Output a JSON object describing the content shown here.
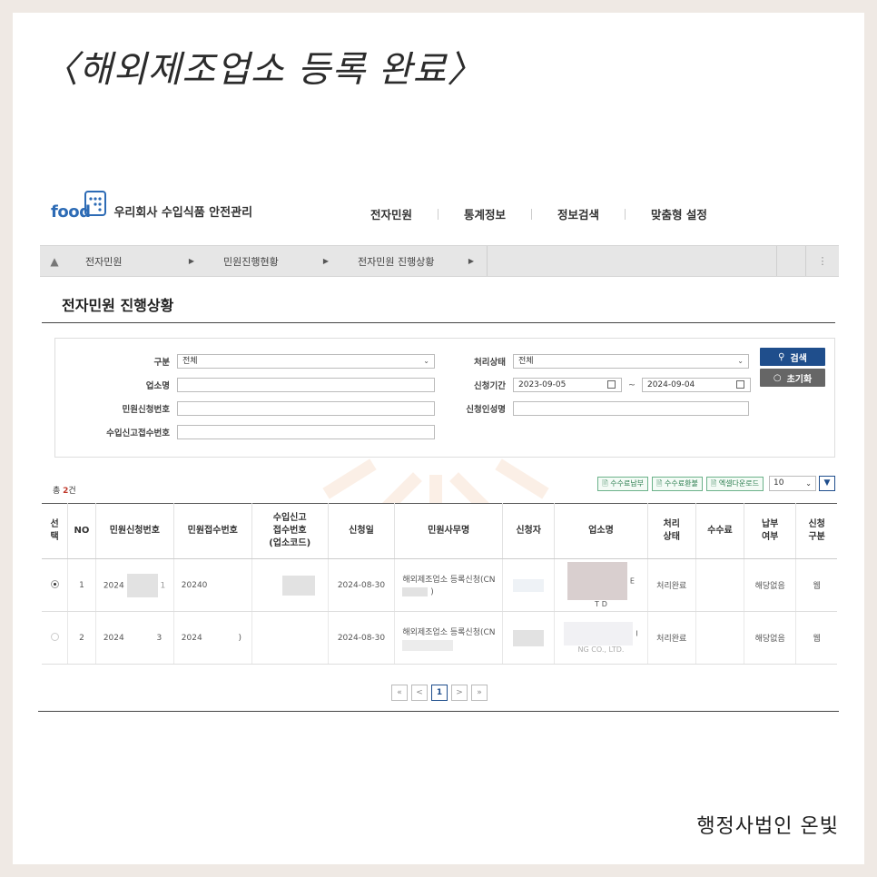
{
  "heading": "〈해외제조업소 등록 완료〉",
  "signature": "행정사법인 온빛",
  "logo": {
    "word": "food",
    "brand": "우리회사 수입식품 안전관리"
  },
  "top_nav": [
    "전자민원",
    "통계정보",
    "정보검색",
    "맞춤형 설정"
  ],
  "breadcrumb": [
    "전자민원",
    "민원진행현황",
    "전자민원 진행상황"
  ],
  "section_title": "전자민원 진행상황",
  "search": {
    "category_label": "구분",
    "category_value": "전체",
    "status_label": "처리상태",
    "status_value": "전체",
    "company_label": "업소명",
    "period_label": "신청기간",
    "date_from": "2023-09-05",
    "date_to": "2024-09-04",
    "request_no_label": "민원신청번호",
    "applicant_name_label": "신청인성명",
    "import_no_label": "수입신고접수번호",
    "search_button": "검색",
    "reset_button": "초기화"
  },
  "result": {
    "total_prefix": "총",
    "total_count": "2",
    "total_suffix": "건",
    "fee_pay": "수수료납부",
    "fee_refund": "수수료환불",
    "excel_download": "엑셀다운로드",
    "page_size": "10"
  },
  "table": {
    "headers": [
      "선\n택",
      "NO",
      "민원신청번호",
      "민원접수번호",
      "수입신고\n접수번호\n(업소코드)",
      "신청일",
      "민원사무명",
      "신청자",
      "업소명",
      "처리\n상태",
      "수수료",
      "납부\n여부",
      "신청\n구분"
    ],
    "rows": [
      {
        "no": "1",
        "req_no": "2024",
        "req_tail": "1",
        "rcpt_no": "20240",
        "date": "2024-08-30",
        "task": "해외제조업소 등록신청(CN",
        "task_tail": ")",
        "company_a": "E",
        "company_b": "T",
        "company_c": "D",
        "status": "처리완료",
        "fee": "",
        "paid": "해당없음",
        "type": "웹"
      },
      {
        "no": "2",
        "req_no": "2024",
        "req_tail": "3",
        "rcpt_no": "2024",
        "rcpt_tail": ")",
        "date": "2024-08-30",
        "task": "해외제조업소 등록신청(CN",
        "company_a": "I",
        "company_b": "NG CO., LTD.",
        "status": "처리완료",
        "fee": "",
        "paid": "해당없음",
        "type": "웹"
      }
    ]
  },
  "pager": {
    "first": "«",
    "prev": "<",
    "current": "1",
    "next": ">",
    "last": "»"
  }
}
